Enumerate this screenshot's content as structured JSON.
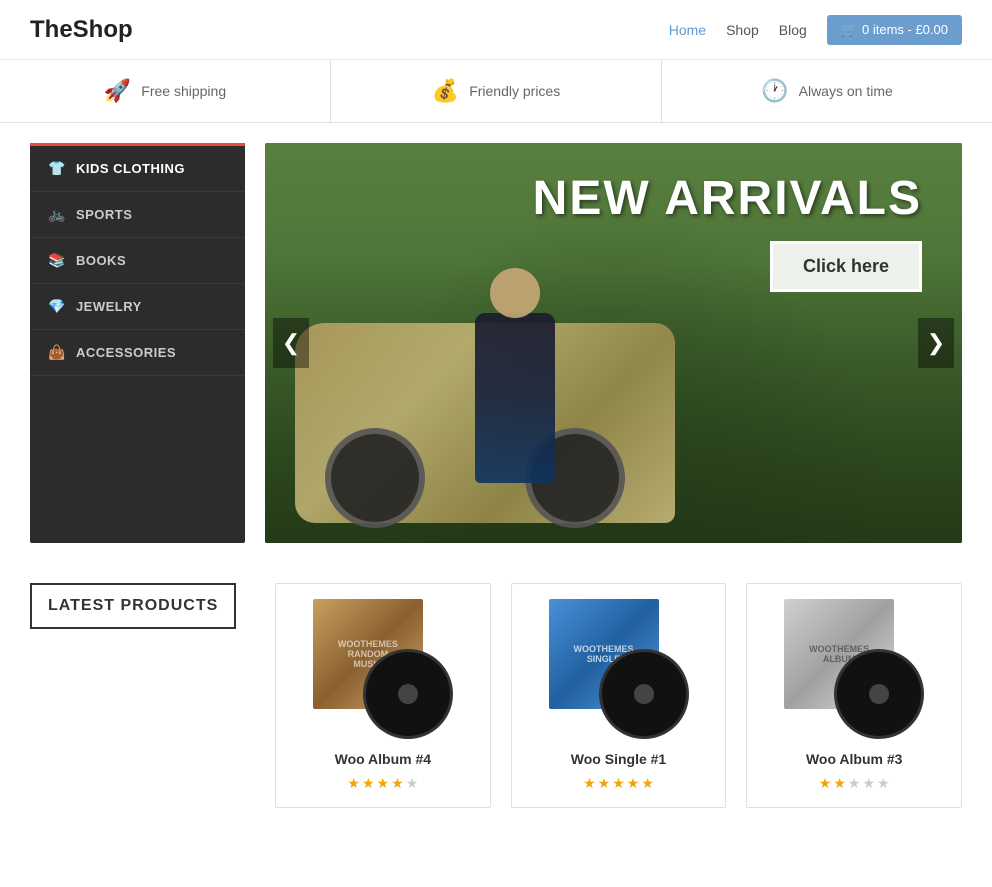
{
  "header": {
    "logo": "TheShop",
    "nav": [
      {
        "label": "Home",
        "active": true
      },
      {
        "label": "Shop",
        "active": false
      },
      {
        "label": "Blog",
        "active": false
      }
    ],
    "cart": {
      "label": "0 items - £0.00",
      "icon": "🛒"
    }
  },
  "features": [
    {
      "icon": "🚀",
      "text": "Free shipping"
    },
    {
      "icon": "💰",
      "text": "Friendly prices"
    },
    {
      "icon": "🕐",
      "text": "Always on time"
    }
  ],
  "sidebar": {
    "items": [
      {
        "label": "Kids Clothing",
        "icon": "👕"
      },
      {
        "label": "Sports",
        "icon": "🚲"
      },
      {
        "label": "Books",
        "icon": "📚"
      },
      {
        "label": "Jewelry",
        "icon": "💎"
      },
      {
        "label": "Accessories",
        "icon": "👜"
      }
    ]
  },
  "hero": {
    "title": "NEW ARRIVALS",
    "cta_label": "Click here",
    "arrow_left": "❮",
    "arrow_right": "❯"
  },
  "products_section": {
    "title": "LATEST PRODUCTS",
    "products": [
      {
        "name": "Woo Album #4",
        "stars": 4,
        "max_stars": 5,
        "sleeve_class": "album-sleeve-1"
      },
      {
        "name": "Woo Single #1",
        "stars": 5,
        "max_stars": 5,
        "sleeve_class": "album-sleeve-2"
      },
      {
        "name": "Woo Album #3",
        "stars": 2,
        "max_stars": 5,
        "sleeve_class": "album-sleeve-3"
      }
    ]
  }
}
